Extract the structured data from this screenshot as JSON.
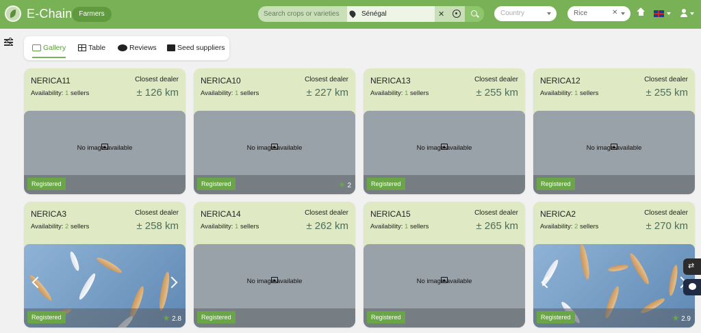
{
  "header": {
    "brand": "E-Chain",
    "role_pill": "Farmers",
    "search_placeholder": "Search crops or varieties",
    "location_value": "Sénégal",
    "country_placeholder": "Country",
    "crop_value": "Rice"
  },
  "tabs": [
    {
      "label": "Gallery",
      "active": true
    },
    {
      "label": "Table"
    },
    {
      "label": "Reviews"
    },
    {
      "label": "Seed suppliers"
    }
  ],
  "card_labels": {
    "closest_dealer": "Closest dealer",
    "availability": "Availability:",
    "sellers": "sellers",
    "no_image": "No image available",
    "registered": "Registered"
  },
  "cards": [
    {
      "name": "NERICA11",
      "sellers": "1",
      "distance": "± 126 km",
      "image": false,
      "rating": ""
    },
    {
      "name": "NERICA10",
      "sellers": "1",
      "distance": "± 227 km",
      "image": false,
      "rating": "2"
    },
    {
      "name": "NERICA13",
      "sellers": "1",
      "distance": "± 255 km",
      "image": false,
      "rating": ""
    },
    {
      "name": "NERICA12",
      "sellers": "1",
      "distance": "± 255 km",
      "image": false,
      "rating": ""
    },
    {
      "name": "NERICA3",
      "sellers": "2",
      "distance": "± 258 km",
      "image": true,
      "rating": "2.8"
    },
    {
      "name": "NERICA14",
      "sellers": "1",
      "distance": "± 262 km",
      "image": false,
      "rating": ""
    },
    {
      "name": "NERICA15",
      "sellers": "1",
      "distance": "± 265 km",
      "image": false,
      "rating": ""
    },
    {
      "name": "NERICA2",
      "sellers": "2",
      "distance": "± 270 km",
      "image": true,
      "rating": "2.9"
    }
  ],
  "colors": {
    "primary": "#79b256",
    "card_bg": "#dfe9c3",
    "accent_text": "#6aa548"
  }
}
